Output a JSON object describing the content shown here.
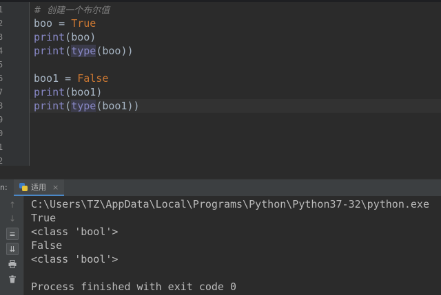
{
  "editor": {
    "line_numbers": [
      "1",
      "2",
      "3",
      "4",
      "5",
      "6",
      "7",
      "8",
      "9",
      "0",
      "1",
      "2"
    ],
    "comment": "#  创建一个布尔值",
    "line2": {
      "var": "boo",
      "op": " = ",
      "value": "True"
    },
    "line3": {
      "fn": "print",
      "open": "(",
      "arg": "boo",
      "close": ")"
    },
    "line4": {
      "fn": "print",
      "open": "(",
      "inner_fn": "type",
      "inner_open": "(",
      "arg": "boo",
      "close": "))"
    },
    "line6": {
      "var": "boo1",
      "op": " = ",
      "value": "False"
    },
    "line7": {
      "fn": "print",
      "open": "(",
      "arg": "boo1",
      "close": ")"
    },
    "line8": {
      "fn": "print",
      "open": "(",
      "inner_fn": "type",
      "inner_open": "(",
      "arg": "boo1",
      "close": "))"
    }
  },
  "run_panel": {
    "label": "n:",
    "tab_title": "适用",
    "tab_close": "×",
    "toolbar_icons": [
      "arrow-up-icon",
      "arrow-down-icon",
      "soft-wrap-icon",
      "scroll-to-end-icon",
      "print-icon",
      "trash-icon"
    ],
    "console_lines": [
      "C:\\Users\\TZ\\AppData\\Local\\Programs\\Python\\Python37-32\\python.exe",
      "True",
      "<class 'bool'>",
      "False",
      "<class 'bool'>",
      "",
      "Process finished with exit code 0"
    ]
  },
  "colors": {
    "background": "#2b2b2b",
    "keyword": "#cc7832",
    "builtin": "#8888c6",
    "text": "#a9b7c6",
    "comment": "#808080"
  }
}
